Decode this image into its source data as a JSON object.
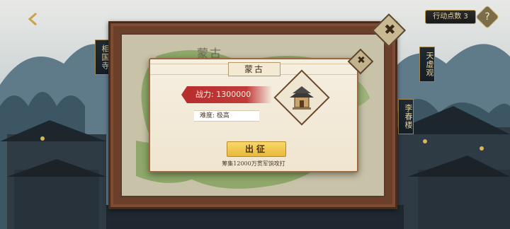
{
  "header": {
    "action_points_label": "行动点数 3",
    "plus_glyph": "?"
  },
  "side_banners": {
    "left": "相国寺",
    "right_top": "天虚观",
    "right_bottom": "李春楼"
  },
  "map": {
    "region_label": "蒙古",
    "close_glyph": "✖"
  },
  "dialog": {
    "title": "蒙古",
    "power_label": "战力: 1300000",
    "difficulty_label": "难度: 极高",
    "march_button": "出征",
    "raise_note": "筹集12000万贯军饷攻打",
    "close_glyph": "✖"
  },
  "colors": {
    "accent_red": "#b82e2e",
    "button_gold": "#e8b83a",
    "frame_brown": "#6b3f2a"
  },
  "icons": {
    "back": "back-arrow-icon",
    "castle": "castle-icon",
    "close": "close-icon"
  }
}
